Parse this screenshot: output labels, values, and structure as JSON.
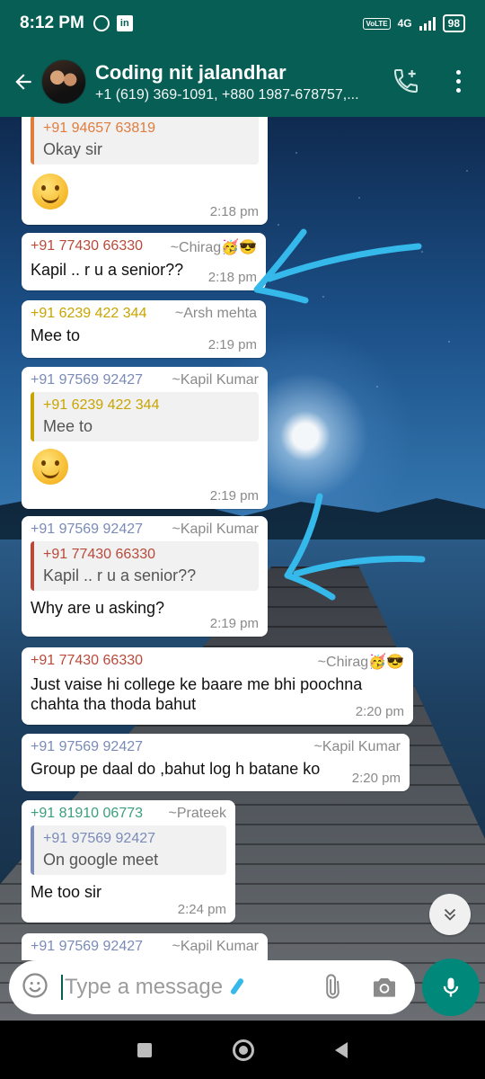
{
  "status_bar": {
    "time": "8:12 PM",
    "network": "4G",
    "volte": "VoLTE",
    "battery": "98"
  },
  "header": {
    "title": "Coding nit jalandhar",
    "subtitle": "+1 (619) 369-1091, +880 1987-678757,..."
  },
  "messages": [
    {
      "id": "m1",
      "phone": "+91 94657 63819",
      "alias": "",
      "body": "Okay sir",
      "time": "2:18 pm"
    },
    {
      "id": "m2",
      "phone": "+91 77430 66330",
      "alias": "~Chirag🥳😎",
      "body": "Kapil .. r u a senior??",
      "time": "2:18 pm"
    },
    {
      "id": "m3",
      "phone": "+91 6239 422 344",
      "alias": "~Arsh mehta",
      "body": "Mee to",
      "time": "2:19 pm"
    },
    {
      "id": "m4",
      "phone": "+91 97569 92427",
      "alias": "~Kapil Kumar",
      "quote": {
        "phone": "+91 6239 422 344",
        "body": "Mee to"
      },
      "time": "2:19 pm"
    },
    {
      "id": "m5",
      "phone": "+91 97569 92427",
      "alias": "~Kapil Kumar",
      "quote": {
        "phone": "+91 77430 66330",
        "body": "Kapil .. r u a senior??"
      },
      "body": "Why are u asking?",
      "time": "2:19 pm"
    },
    {
      "id": "m6",
      "phone": "+91 77430 66330",
      "alias": "~Chirag🥳😎",
      "body": "Just vaise hi college ke baare me bhi poochna chahta tha thoda bahut",
      "time": "2:20 pm"
    },
    {
      "id": "m7",
      "phone": "+91 97569 92427",
      "alias": "~Kapil Kumar",
      "body": "Group pe daal do ,bahut log h batane ko",
      "time": "2:20 pm"
    },
    {
      "id": "m8",
      "phone": "+91 81910 06773",
      "alias": "~Prateek",
      "quote": {
        "phone": "+91 97569 92427",
        "body": "On google meet"
      },
      "body": "Me too sir",
      "time": "2:24 pm"
    },
    {
      "id": "m9",
      "phone": "+91 97569 92427",
      "alias": "~Kapil Kumar"
    }
  ],
  "input": {
    "placeholder": "Type a message"
  },
  "icons": {
    "back": "arrow-left-icon",
    "call_add": "add-call-icon",
    "menu": "more-vert-icon",
    "emoji": "emoji-icon",
    "attach": "paperclip-icon",
    "camera": "camera-icon",
    "mic": "mic-icon",
    "scroll": "double-chevron-down-icon"
  },
  "colors": {
    "header": "#075e54",
    "mic": "#00897b",
    "annotation": "#35b8ea"
  }
}
